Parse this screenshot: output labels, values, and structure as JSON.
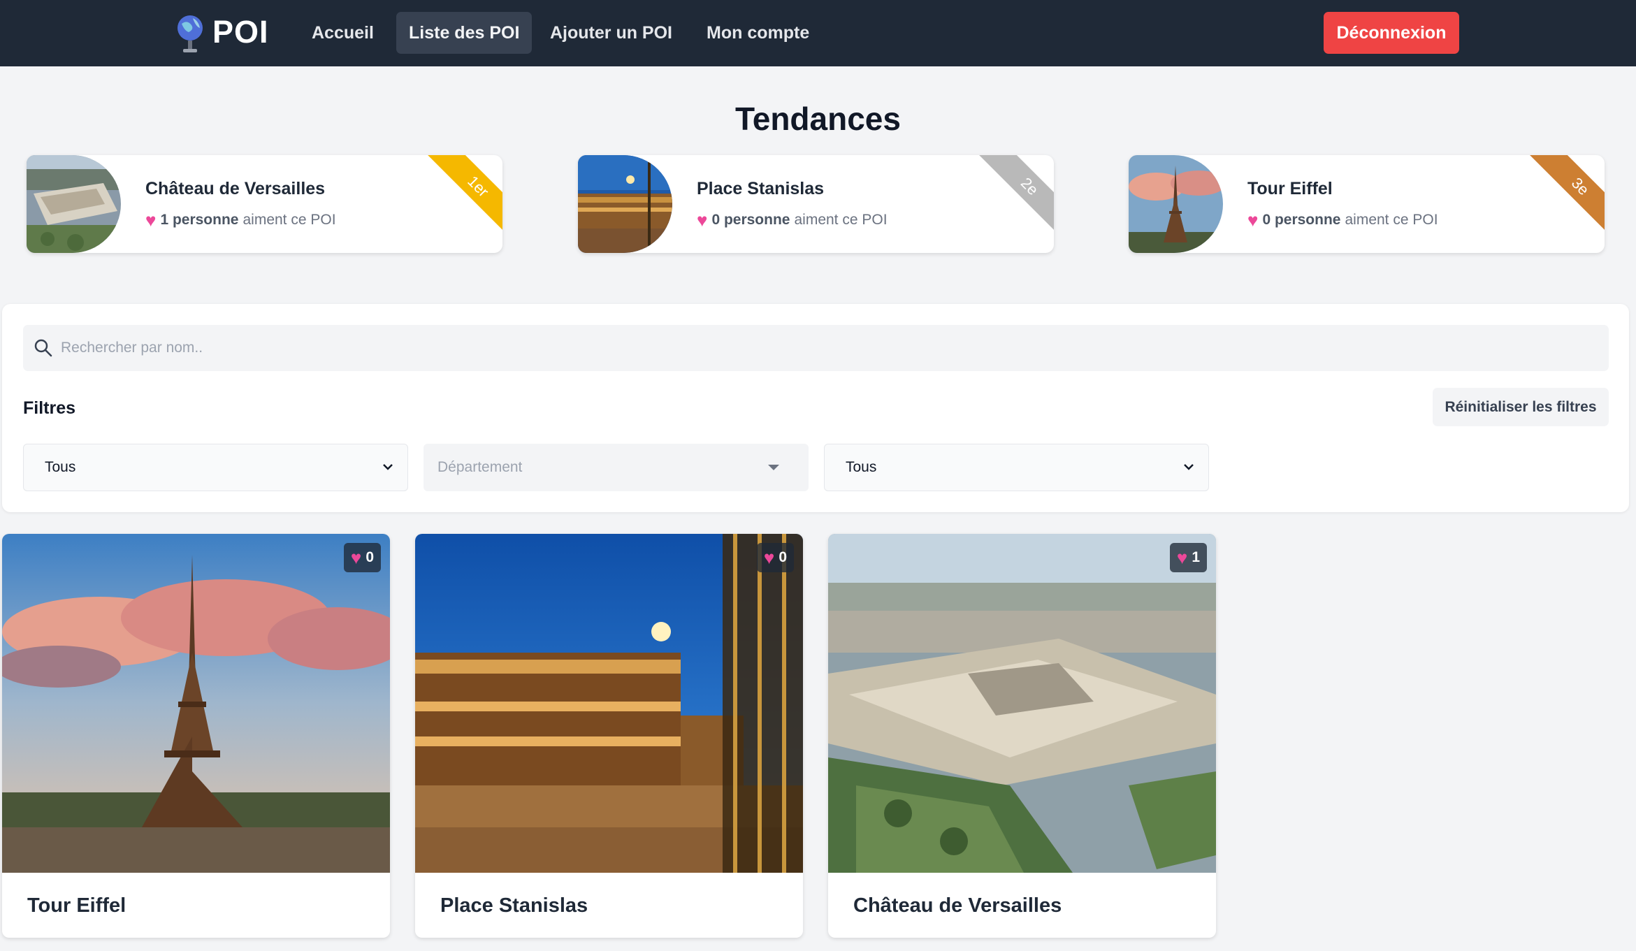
{
  "nav": {
    "brand": "POI",
    "links": [
      "Accueil",
      "Liste des POI",
      "Ajouter un POI",
      "Mon compte"
    ],
    "active_link": "Liste des POI",
    "logout": "Déconnexion"
  },
  "trending": {
    "title": "Tendances",
    "items": [
      {
        "name": "Château de Versailles",
        "count": "1 personne",
        "text": "aiment ce POI",
        "rank": "1er",
        "rank_color": "#f5b800",
        "image": "versailles-thumb"
      },
      {
        "name": "Place Stanislas",
        "count": "0 personne",
        "text": "aiment ce POI",
        "rank": "2e",
        "rank_color": "#b9b9b9",
        "image": "stanislas-thumb"
      },
      {
        "name": "Tour Eiffel",
        "count": "0 personne",
        "text": "aiment ce POI",
        "rank": "3e",
        "rank_color": "#cd7f32",
        "image": "eiffel-thumb"
      }
    ]
  },
  "filters": {
    "search_placeholder": "Rechercher par nom..",
    "label": "Filtres",
    "reset": "Réinitialiser les filtres",
    "select1": "Tous",
    "department_placeholder": "Département",
    "select3": "Tous"
  },
  "pois": [
    {
      "name": "Tour Eiffel",
      "likes": "0",
      "image": "eiffel-photo"
    },
    {
      "name": "Place Stanislas",
      "likes": "0",
      "image": "stanislas-photo"
    },
    {
      "name": "Château de Versailles",
      "likes": "1",
      "image": "versailles-photo"
    }
  ],
  "colors": {
    "navbar": "#1f2937",
    "logout": "#ef4444",
    "heart": "#ec4899",
    "background": "#f3f4f6"
  }
}
